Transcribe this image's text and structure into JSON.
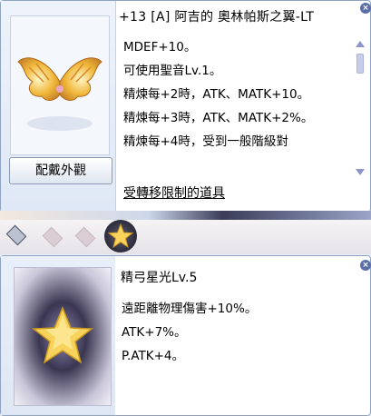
{
  "item_window": {
    "title": "+13 [A] 阿吉的 奧林帕斯之翼-LT",
    "equip_button": "配戴外觀",
    "description": [
      "MDEF+10。",
      "可使用聖音Lv.1。",
      "精煉每+2時，ATK、MATK+10。",
      "精煉每+3時，ATK、MATK+2%。",
      "精煉每+4時，受到一般階級對"
    ],
    "restriction_link": "受轉移限制的道具",
    "icons": {
      "image": "golden-wings-icon",
      "close": "close-icon",
      "scroll_up": "scroll-up-arrow-icon",
      "scroll_down": "scroll-down-arrow-icon"
    }
  },
  "slot_bar": {
    "slots": [
      "empty-slot",
      "empty-slot",
      "empty-slot",
      "card-slot-star"
    ]
  },
  "card_window": {
    "title": "精弓星光Lv.5",
    "description": [
      "遠距離物理傷害+10%。",
      "ATK+7%。",
      "P.ATK+4。"
    ],
    "icons": {
      "image": "star-card-icon",
      "close": "close-icon"
    }
  },
  "colors": {
    "border": "#8ea3c2",
    "panel_bg": "#e8eef7",
    "scroll_arrow": "#8b95c9"
  }
}
